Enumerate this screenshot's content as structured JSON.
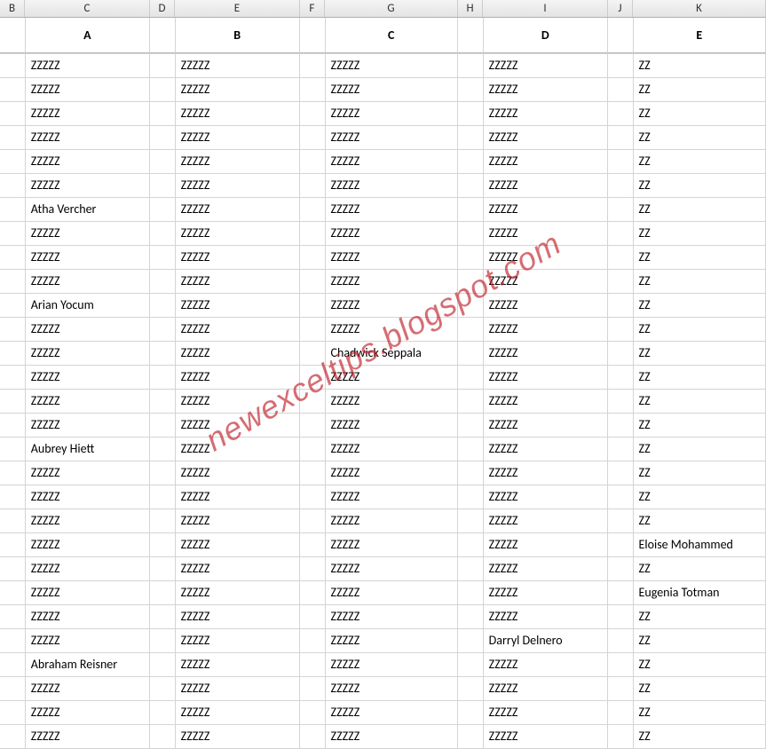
{
  "columnHeaders": [
    "B",
    "C",
    "D",
    "E",
    "F",
    "G",
    "H",
    "I",
    "J",
    "K"
  ],
  "headerRow": {
    "C": "A",
    "E": "B",
    "G": "C",
    "I": "D",
    "K": "E"
  },
  "rows": [
    {
      "C": "ZZZZZ",
      "E": "ZZZZZ",
      "G": "ZZZZZ",
      "I": "ZZZZZ",
      "K": "ZZ"
    },
    {
      "C": "ZZZZZ",
      "E": "ZZZZZ",
      "G": "ZZZZZ",
      "I": "ZZZZZ",
      "K": "ZZ"
    },
    {
      "C": "ZZZZZ",
      "E": "ZZZZZ",
      "G": "ZZZZZ",
      "I": "ZZZZZ",
      "K": "ZZ"
    },
    {
      "C": "ZZZZZ",
      "E": "ZZZZZ",
      "G": "ZZZZZ",
      "I": "ZZZZZ",
      "K": "ZZ"
    },
    {
      "C": "ZZZZZ",
      "E": "ZZZZZ",
      "G": "ZZZZZ",
      "I": "ZZZZZ",
      "K": "ZZ"
    },
    {
      "C": "ZZZZZ",
      "E": "ZZZZZ",
      "G": "ZZZZZ",
      "I": "ZZZZZ",
      "K": "ZZ"
    },
    {
      "C": "Atha Vercher",
      "E": "ZZZZZ",
      "G": "ZZZZZ",
      "I": "ZZZZZ",
      "K": "ZZ"
    },
    {
      "C": "ZZZZZ",
      "E": "ZZZZZ",
      "G": "ZZZZZ",
      "I": "ZZZZZ",
      "K": "ZZ"
    },
    {
      "C": "ZZZZZ",
      "E": "ZZZZZ",
      "G": "ZZZZZ",
      "I": "ZZZZZ",
      "K": "ZZ"
    },
    {
      "C": "ZZZZZ",
      "E": "ZZZZZ",
      "G": "ZZZZZ",
      "I": "ZZZZZ",
      "K": "ZZ"
    },
    {
      "C": "Arian Yocum",
      "E": "ZZZZZ",
      "G": "ZZZZZ",
      "I": "ZZZZZ",
      "K": "ZZ"
    },
    {
      "C": "ZZZZZ",
      "E": "ZZZZZ",
      "G": "ZZZZZ",
      "I": "ZZZZZ",
      "K": "ZZ"
    },
    {
      "C": "ZZZZZ",
      "E": "ZZZZZ",
      "G": "Chadwick Seppala",
      "I": "ZZZZZ",
      "K": "ZZ"
    },
    {
      "C": "ZZZZZ",
      "E": "ZZZZZ",
      "G": "ZZZZZ",
      "I": "ZZZZZ",
      "K": "ZZ"
    },
    {
      "C": "ZZZZZ",
      "E": "ZZZZZ",
      "G": "ZZZZZ",
      "I": "ZZZZZ",
      "K": "ZZ"
    },
    {
      "C": "ZZZZZ",
      "E": "ZZZZZ",
      "G": "ZZZZZ",
      "I": "ZZZZZ",
      "K": "ZZ"
    },
    {
      "C": "Aubrey Hiett",
      "E": "ZZZZZ",
      "G": "ZZZZZ",
      "I": "ZZZZZ",
      "K": "ZZ"
    },
    {
      "C": "ZZZZZ",
      "E": "ZZZZZ",
      "G": "ZZZZZ",
      "I": "ZZZZZ",
      "K": "ZZ"
    },
    {
      "C": "ZZZZZ",
      "E": "ZZZZZ",
      "G": "ZZZZZ",
      "I": "ZZZZZ",
      "K": "ZZ"
    },
    {
      "C": "ZZZZZ",
      "E": "ZZZZZ",
      "G": "ZZZZZ",
      "I": "ZZZZZ",
      "K": "ZZ"
    },
    {
      "C": "ZZZZZ",
      "E": "ZZZZZ",
      "G": "ZZZZZ",
      "I": "ZZZZZ",
      "K": "Eloise Mohammed"
    },
    {
      "C": "ZZZZZ",
      "E": "ZZZZZ",
      "G": "ZZZZZ",
      "I": "ZZZZZ",
      "K": "ZZ"
    },
    {
      "C": "ZZZZZ",
      "E": "ZZZZZ",
      "G": "ZZZZZ",
      "I": "ZZZZZ",
      "K": "Eugenia Totman"
    },
    {
      "C": "ZZZZZ",
      "E": "ZZZZZ",
      "G": "ZZZZZ",
      "I": "ZZZZZ",
      "K": "ZZ"
    },
    {
      "C": "ZZZZZ",
      "E": "ZZZZZ",
      "G": "ZZZZZ",
      "I": "Darryl Delnero",
      "K": "ZZ"
    },
    {
      "C": "Abraham Reisner",
      "E": "ZZZZZ",
      "G": "ZZZZZ",
      "I": "ZZZZZ",
      "K": "ZZ"
    },
    {
      "C": "ZZZZZ",
      "E": "ZZZZZ",
      "G": "ZZZZZ",
      "I": "ZZZZZ",
      "K": "ZZ"
    },
    {
      "C": "ZZZZZ",
      "E": "ZZZZZ",
      "G": "ZZZZZ",
      "I": "ZZZZZ",
      "K": "ZZ"
    },
    {
      "C": "ZZZZZ",
      "E": "ZZZZZ",
      "G": "ZZZZZ",
      "I": "ZZZZZ",
      "K": "ZZ"
    }
  ],
  "watermark": "newexceltips.blogspot.com"
}
